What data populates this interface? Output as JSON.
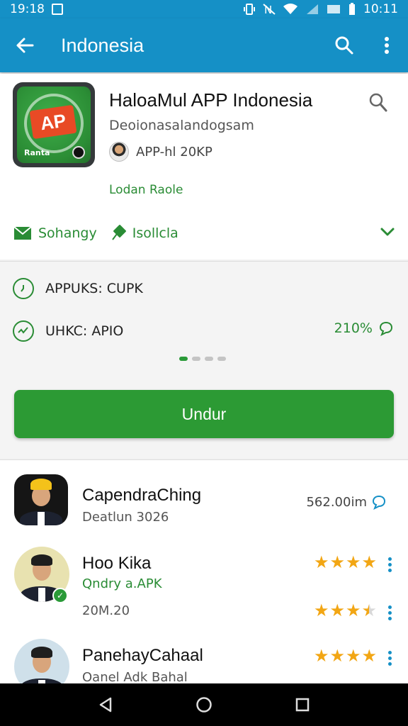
{
  "status_bar": {
    "time_left": "19:18",
    "time_right": "10:11"
  },
  "app_bar": {
    "title": "Indonesia"
  },
  "app": {
    "title": "HaloaMul APP Indonesia",
    "subtitle": "Deoionasalandogsam",
    "developer": "APP-hl 20KP",
    "link": "Lodan Raole",
    "icon_label": "AP",
    "icon_small": "Ranta"
  },
  "actions": [
    {
      "label": "Sohangy",
      "icon": "mail-icon"
    },
    {
      "label": "Isollcla",
      "icon": "pin-icon"
    }
  ],
  "info": {
    "row1": "APPUKS: CUPK",
    "row2": "UHKC: APIO",
    "percent": "210%"
  },
  "pager": {
    "count": 4,
    "active": 0
  },
  "download_button": "Undur",
  "reviews": [
    {
      "name": "CapendraChing",
      "sub": "Deatlun 3026",
      "meta": "562.00im",
      "rating": 0
    },
    {
      "name": "Hoo Kika",
      "sub": "Qndry a.APK",
      "extra": "20M.20",
      "rating": 4,
      "rating2": 3.5
    },
    {
      "name": "PanehayCahaal",
      "sub": "Oanel Adk Bahal",
      "rating": 4
    }
  ],
  "colors": {
    "primary": "#1590c6",
    "accent_green": "#2c9a34",
    "star": "#f2a614"
  }
}
